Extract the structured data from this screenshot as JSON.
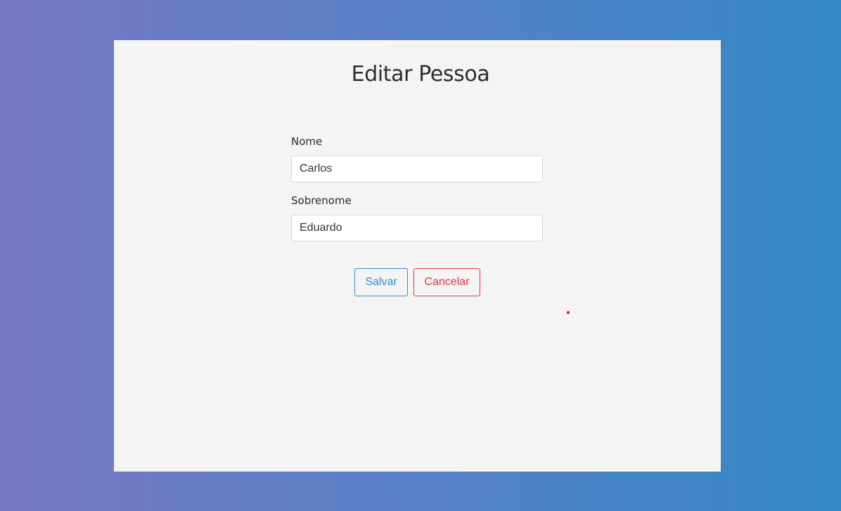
{
  "form": {
    "title": "Editar Pessoa",
    "nome_label": "Nome",
    "nome_value": "Carlos",
    "sobrenome_label": "Sobrenome",
    "sobrenome_value": "Eduardo",
    "save_label": "Salvar",
    "cancel_label": "Cancelar"
  },
  "colors": {
    "save_accent": "#3a8dc4",
    "cancel_accent": "#dc3545",
    "card_background": "#f4f4f4"
  }
}
